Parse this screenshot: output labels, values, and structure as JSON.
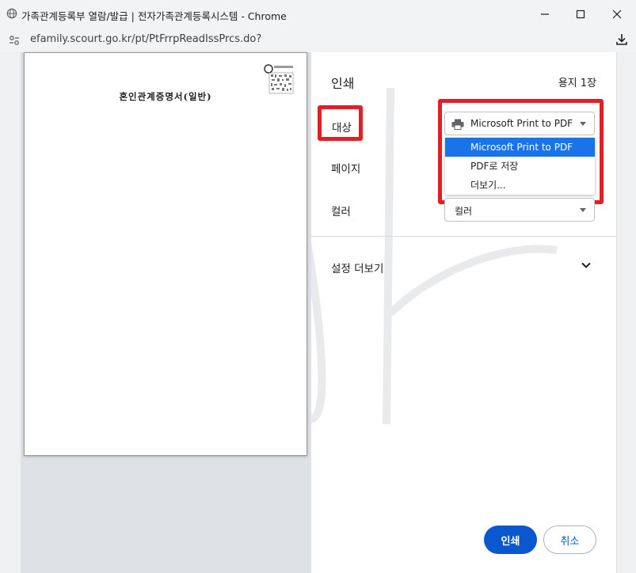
{
  "window": {
    "title": "가족관계등록부 열람/발급 | 전자가족관계등록시스템 - Chrome",
    "url": "efamily.scourt.go.kr/pt/PtFrrpReadIssPrcs.do?"
  },
  "preview": {
    "document_title": "혼인관계증명서(일반)"
  },
  "print": {
    "title": "인쇄",
    "sheet_count": "용지 1장",
    "destination_label": "대상",
    "destination_value": "Microsoft Print to PDF",
    "destination_options": [
      "Microsoft Print to PDF",
      "PDF로 저장",
      "더보기..."
    ],
    "pages_label": "페이지",
    "color_label": "컬러",
    "color_value": "컬러",
    "more_settings": "설정 더보기",
    "print_button": "인쇄",
    "cancel_button": "취소"
  },
  "colors": {
    "highlight_red": "#e31e24",
    "accent_blue": "#0b57d0",
    "selected_option": "#1a73e8"
  },
  "icons": [
    "globe-icon",
    "minimize-icon",
    "maximize-icon",
    "close-icon",
    "site-settings-icon",
    "download-icon",
    "printer-icon",
    "chevron-down-icon"
  ]
}
